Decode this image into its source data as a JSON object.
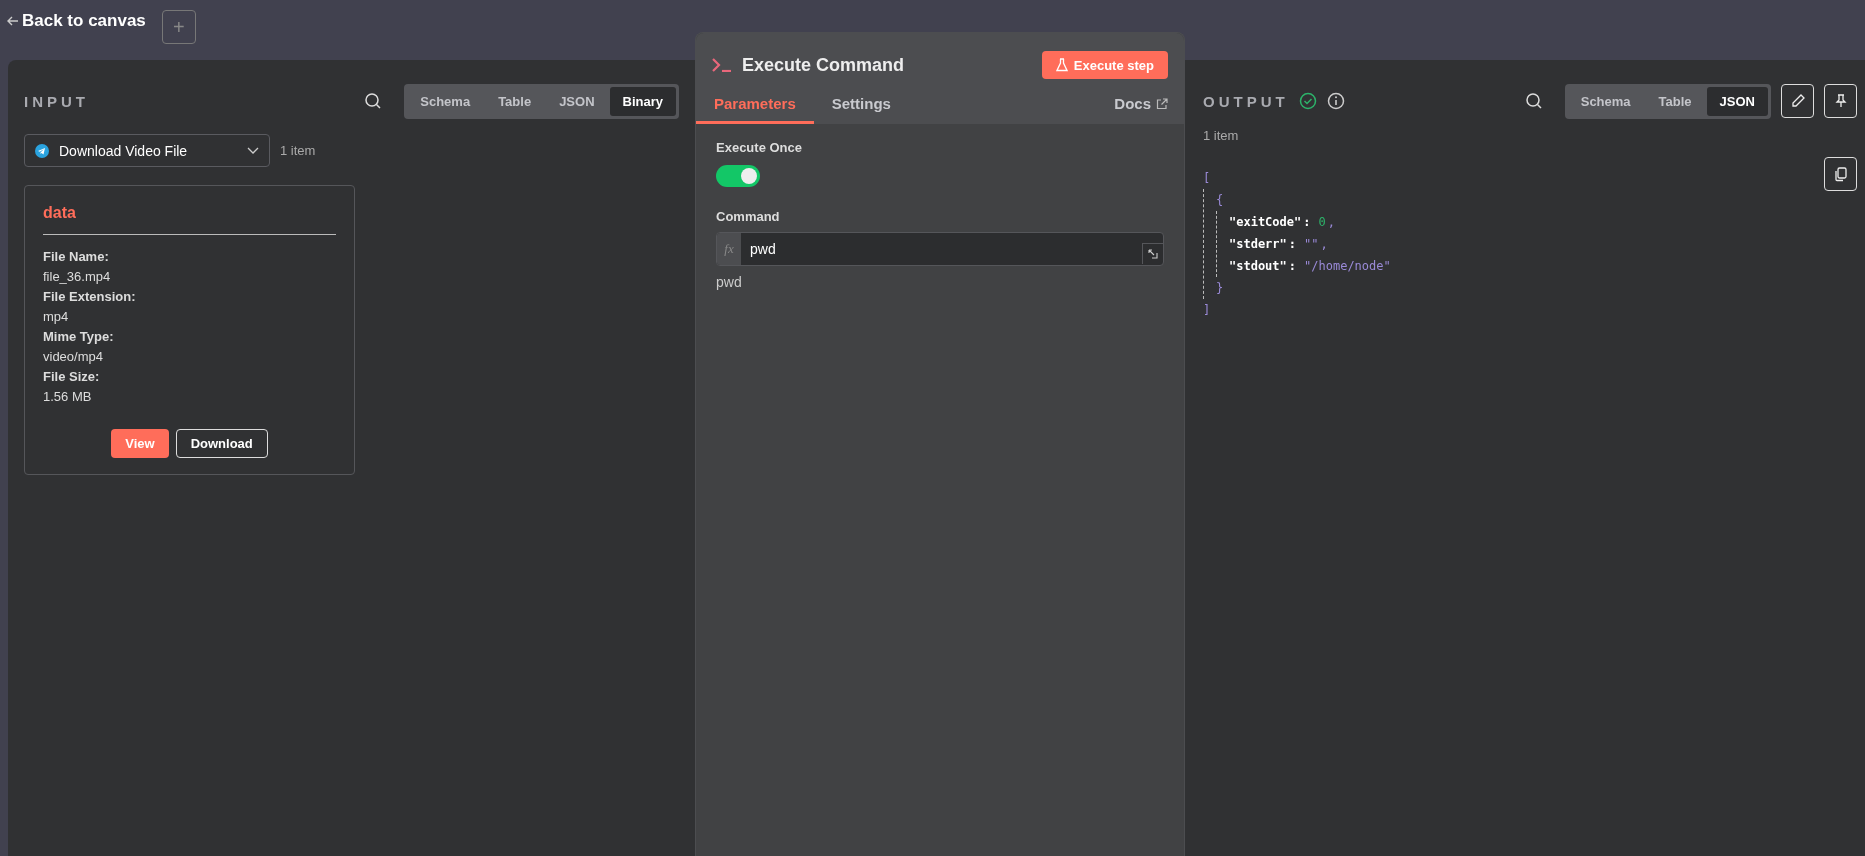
{
  "top_bar": {
    "back_label": "Back to canvas",
    "add_label": "+"
  },
  "input": {
    "title": "INPUT",
    "tabs": [
      {
        "label": "Schema",
        "selected": false
      },
      {
        "label": "Table",
        "selected": false
      },
      {
        "label": "JSON",
        "selected": false
      },
      {
        "label": "Binary",
        "selected": true
      }
    ],
    "node_select": "Download Video File",
    "item_count": "1 item",
    "binary_card": {
      "title": "data",
      "fields": [
        {
          "label": "File Name:",
          "value": "file_36.mp4"
        },
        {
          "label": "File Extension:",
          "value": "mp4"
        },
        {
          "label": "Mime Type:",
          "value": "video/mp4"
        },
        {
          "label": "File Size:",
          "value": "1.56 MB"
        }
      ],
      "buttons": [
        {
          "label": "View",
          "kind": "primary"
        },
        {
          "label": "Download",
          "kind": "outline"
        }
      ]
    }
  },
  "node": {
    "title": "Execute Command",
    "execute_button": "Execute step",
    "tabs": [
      {
        "label": "Parameters",
        "selected": true
      },
      {
        "label": "Settings",
        "selected": false
      }
    ],
    "docs_link": "Docs",
    "execute_once": {
      "label": "Execute Once",
      "on": true
    },
    "command": {
      "label": "Command",
      "fx": "fx",
      "value": "pwd",
      "preview": "pwd"
    }
  },
  "output": {
    "title": "OUTPUT",
    "success": true,
    "tabs": [
      {
        "label": "Schema",
        "selected": false
      },
      {
        "label": "Table",
        "selected": false
      },
      {
        "label": "JSON",
        "selected": true
      }
    ],
    "item_count": "1 item",
    "json": {
      "open": "[",
      "object_open": "{",
      "fields": [
        {
          "key": "\"exitCode\"",
          "colon": ":",
          "value": "0",
          "kind": "number",
          "comma": ","
        },
        {
          "key": "\"stderr\"",
          "colon": ":",
          "value": "\"\"",
          "kind": "string",
          "comma": ","
        },
        {
          "key": "\"stdout\"",
          "colon": ":",
          "value": "\"/home/node\"",
          "kind": "string"
        }
      ],
      "object_close": "}",
      "close": "]"
    }
  }
}
